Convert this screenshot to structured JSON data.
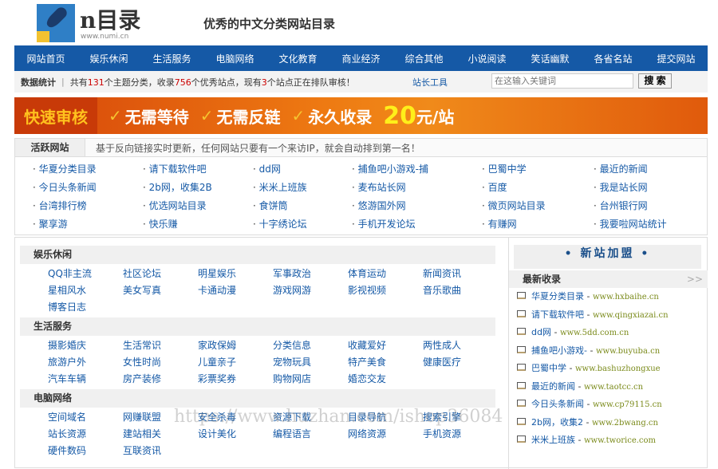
{
  "header": {
    "brand": "n目录",
    "brand_url": "www.numi.cn",
    "slogan": "优秀的中文分类网站目录"
  },
  "nav": [
    "网站首页",
    "娱乐休闲",
    "生活服务",
    "电脑网络",
    "文化教育",
    "商业经济",
    "综合其他",
    "小说阅读",
    "笑话幽默",
    "各省名站",
    "提交网站"
  ],
  "stats": {
    "label": "数据统计",
    "sep": "|",
    "t1": "共有",
    "n1": "131",
    "t2": "个主题分类，收录",
    "n2": "756",
    "t3": "个优秀站点，现有",
    "n3": "3",
    "t4": "个站点正在排队审核！",
    "tools": "站长工具",
    "search_placeholder": "在这输入关键词",
    "search_button": "搜 索"
  },
  "banner": {
    "first": "快速审核",
    "items": [
      "无需等待",
      "无需反链",
      "永久收录"
    ],
    "price": "20",
    "unit": "元/站"
  },
  "active": {
    "title": "活跃网站",
    "desc": "基于反向链接实时更新，任何网站只要有一个来访IP，就会自动排到第一名！",
    "links": [
      "华夏分类目录",
      "请下载软件吧",
      "dd网",
      "捕鱼吧小游戏-捕",
      "巴蜀中学",
      "最近的新闻",
      "今日头条新闻",
      "2b网，收集2B",
      "米米上班族",
      "麦布站长网",
      "百度",
      "我是站长网",
      "台湾排行榜",
      "优选网站目录",
      "食饼筒",
      "悠游国外网",
      "微页网站目录",
      "台州银行网",
      "聚享游",
      "快乐赚",
      "十字绣论坛",
      "手机开发论坛",
      "有赚网",
      "我要啦网站统计"
    ]
  },
  "categories": [
    {
      "title": "娱乐休闲",
      "items": [
        "QQ非主流",
        "社区论坛",
        "明星娱乐",
        "军事政治",
        "体育运动",
        "新闻资讯",
        "星相风水",
        "美女写真",
        "卡通动漫",
        "游戏网游",
        "影视视频",
        "音乐歌曲",
        "博客日志"
      ]
    },
    {
      "title": "生活服务",
      "items": [
        "摄影婚庆",
        "生活常识",
        "家政保姆",
        "分类信息",
        "收藏爱好",
        "两性成人",
        "旅游户外",
        "女性时尚",
        "儿童亲子",
        "宠物玩具",
        "特产美食",
        "健康医疗",
        "汽车车辆",
        "房产装修",
        "彩票奖券",
        "购物网店",
        "婚恋交友"
      ]
    },
    {
      "title": "电脑网络",
      "items": [
        "空间域名",
        "网赚联盟",
        "安全杀毒",
        "资源下载",
        "目录导航",
        "搜索引擎",
        "站长资源",
        "建站相关",
        "设计美化",
        "编程语言",
        "网络资源",
        "手机资源",
        "硬件数码",
        "互联资讯"
      ]
    }
  ],
  "sidebar": {
    "join": "• 新站加盟 •",
    "latest_title": "最新收录",
    "more": ">>",
    "latest": [
      {
        "name": "华夏分类目录",
        "url": "www.hxbaihe.cn"
      },
      {
        "name": "请下载软件吧",
        "url": "www.qingxiazai.cn"
      },
      {
        "name": "dd网",
        "url": "www.5dd.com.cn"
      },
      {
        "name": "捕鱼吧小游戏-",
        "url": "www.buyuba.cn"
      },
      {
        "name": "巴蜀中学",
        "url": "www.bashuzhongxue"
      },
      {
        "name": "最近的新闻",
        "url": "www.taotcc.cn"
      },
      {
        "name": "今日头条新闻",
        "url": "www.cp79115.cn"
      },
      {
        "name": "2b网，收集2",
        "url": "www.2bwang.cn"
      },
      {
        "name": "米米上班族",
        "url": "www.tworice.com"
      }
    ]
  },
  "watermark": "https://www.huzhan.com/ishop36084"
}
